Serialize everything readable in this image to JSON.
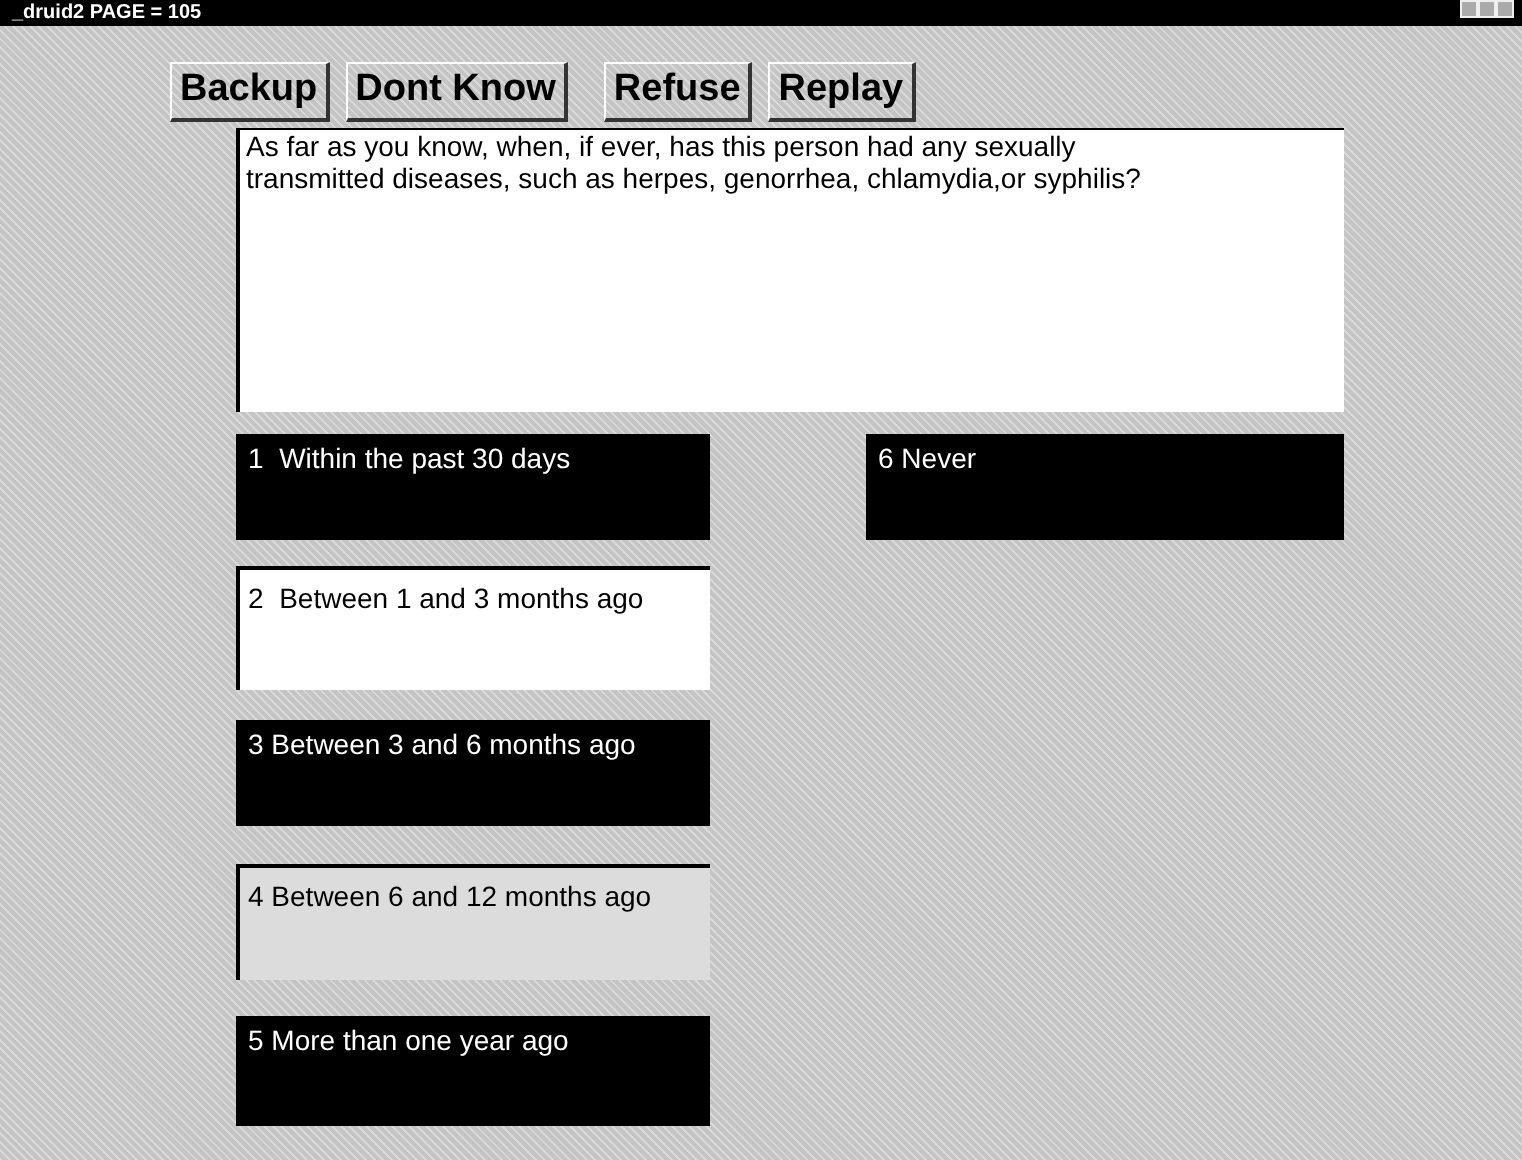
{
  "window": {
    "title": "_druid2 PAGE = 105"
  },
  "buttons": [
    "Backup",
    "Dont Know",
    "Refuse",
    "Replay"
  ],
  "question": "As far as you know, when, if ever, has this person had any sexually transmitted diseases, such as herpes, genorrhea, chlamydia,or syphilis?",
  "answers_left": [
    {
      "label": "1  Within the past 30 days",
      "kind": "dark"
    },
    {
      "label": "2  Between 1 and 3 months ago",
      "kind": "white"
    },
    {
      "label": "3 Between 3 and 6 months ago",
      "kind": "dark"
    },
    {
      "label": "4 Between 6 and 12 months ago",
      "kind": "grey"
    },
    {
      "label": "5 More than one year ago",
      "kind": "dark"
    }
  ],
  "answers_right": [
    {
      "label": "6 Never",
      "kind": "dark"
    }
  ]
}
